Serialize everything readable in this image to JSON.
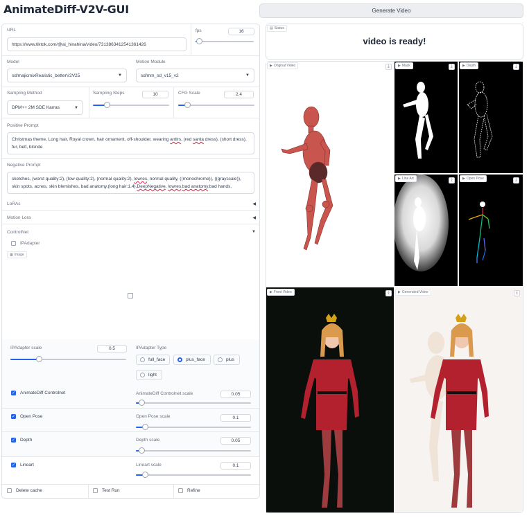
{
  "app_title": "AnimateDiff-V2V-GUI",
  "generate_button": "Generate Video",
  "url": {
    "label": "URL",
    "value": "https://www.tiktok.com/@ai_hinahina/video/7313863412541361426"
  },
  "fps": {
    "label": "fps",
    "value": "16",
    "fraction": 0.07
  },
  "model": {
    "label": "Model",
    "value": "sd/majicmixRealistic_betterV2V25"
  },
  "motion_module": {
    "label": "Motion Module",
    "value": "sd/mm_sd_v15_v2"
  },
  "sampling_method": {
    "label": "Sampling Method",
    "value": "DPM++ 2M SDE Karras"
  },
  "sampling_steps": {
    "label": "Sampling Steps",
    "value": "10",
    "fraction": 0.19
  },
  "cfg_scale": {
    "label": "CFG Scale",
    "value": "2.4",
    "fraction": 0.12
  },
  "positive_prompt": {
    "label": "Positive Prompt",
    "value_a": "Christmas theme, Long hair, Royal crown, hair ornament, off-shoulder, wearing ",
    "value_b": "antlrs",
    "value_c": ", (red ",
    "value_d": "santa",
    "value_e": " dress), (short dress), fur, belt, blonde"
  },
  "negative_prompt": {
    "label": "Negative Prompt",
    "line1_a": "sketches, (worst quality:2), (low quality:2), (normal quality:2), ",
    "line1_b": "lowres",
    "line1_c": ", normal quality, ((monochrome)), ((grayscale)),",
    "line2_a": "skin spots, acnes, skin blemishes, bad anatomy,(long hair:1.4),",
    "line2_b": "DeepNegative",
    "line2_c": ", ",
    "line2_d": "lowres",
    "line2_e": ",",
    "line2_f": "bad anatomy",
    "line2_g": ",bad hands,"
  },
  "accordions": {
    "loras": "LoRAs",
    "motion_lora": "Motion Lora",
    "controlnet": "ControlNet"
  },
  "ipadapter": {
    "checkbox": "IPAdapter",
    "image_tag": "Image",
    "scale_label": "IPAdapter scale",
    "scale_value": "0.5",
    "scale_fraction": 0.25,
    "type_label": "IPAdapter Type",
    "types": [
      "full_face",
      "plus_face",
      "plus",
      "light"
    ],
    "selected": "plus_face"
  },
  "controlnets": [
    {
      "name": "AnimateDiff Controlnet",
      "scale_label": "AnimateDiff Controlnet scale",
      "value": "0.05",
      "fraction": 0.05
    },
    {
      "name": "Open Pose",
      "scale_label": "Open Pose scale",
      "value": "0.1",
      "fraction": 0.08
    },
    {
      "name": "Depth",
      "scale_label": "Depth scale",
      "value": "0.05",
      "fraction": 0.05
    },
    {
      "name": "Lineart",
      "scale_label": "Lineart scale",
      "value": "0.1",
      "fraction": 0.08
    }
  ],
  "bottom_options": [
    "Delete cache",
    "Test Run",
    "Refine"
  ],
  "status": {
    "tag": "Status",
    "message": "video is ready!"
  },
  "media": {
    "original": "Original Video",
    "mask": "Mask",
    "depth": "Depth",
    "lineart": "Line Art",
    "openpose": "Open Pose",
    "front": "Front Video",
    "generated": "Generated Video"
  },
  "colors": {
    "accent": "#2563eb",
    "border": "#dde1e6",
    "dress": "#b3202e"
  }
}
